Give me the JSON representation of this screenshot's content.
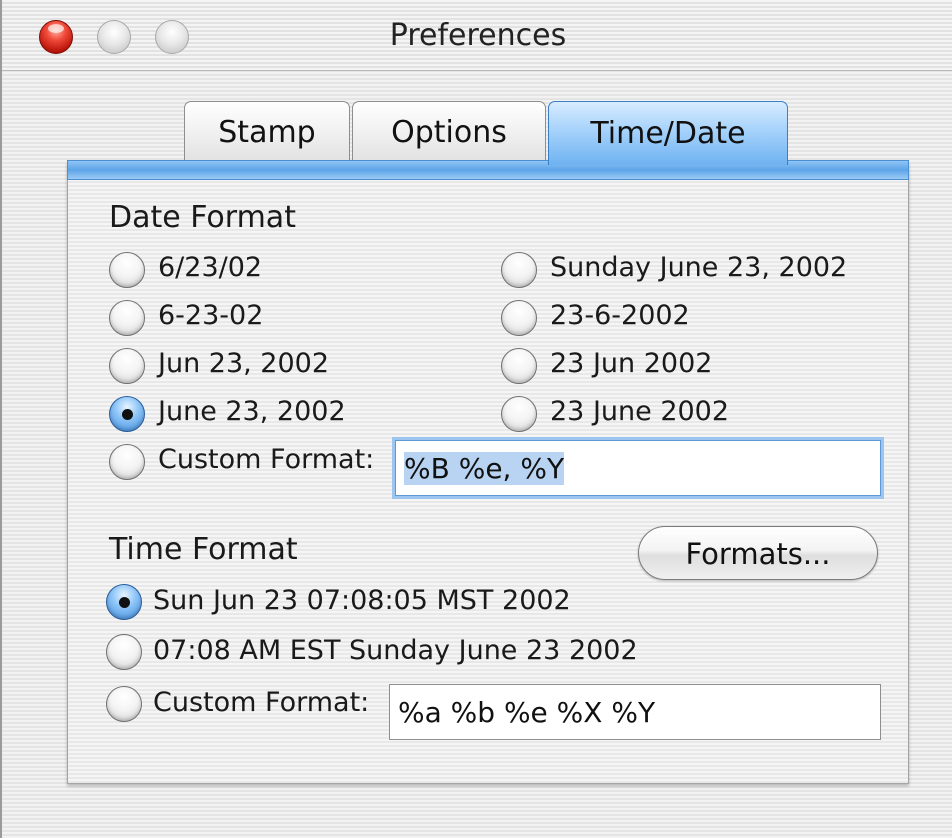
{
  "window": {
    "title": "Preferences"
  },
  "tabs": [
    {
      "label": "Stamp",
      "selected": false
    },
    {
      "label": "Options",
      "selected": false
    },
    {
      "label": "Time/Date",
      "selected": true
    }
  ],
  "date_format": {
    "heading": "Date Format",
    "options": [
      {
        "label": "6/23/02",
        "selected": false
      },
      {
        "label": "6-23-02",
        "selected": false
      },
      {
        "label": "Jun 23, 2002",
        "selected": false
      },
      {
        "label": "June 23, 2002",
        "selected": true
      },
      {
        "label": "Sunday June 23, 2002",
        "selected": false
      },
      {
        "label": "23-6-2002",
        "selected": false
      },
      {
        "label": "23 Jun 2002",
        "selected": false
      },
      {
        "label": "23 June 2002",
        "selected": false
      }
    ],
    "custom_label": "Custom Format:",
    "custom_selected": false,
    "custom_value": "%B %e, %Y"
  },
  "time_format": {
    "heading": "Time Format",
    "formats_button": "Formats...",
    "options": [
      {
        "label": "Sun Jun 23 07:08:05 MST 2002",
        "selected": true
      },
      {
        "label": "07:08 AM EST Sunday June 23 2002",
        "selected": false
      }
    ],
    "custom_label": "Custom Format:",
    "custom_selected": false,
    "custom_value": "%a %b %e %X %Y"
  },
  "colors": {
    "accent": "#6eb2f1",
    "selection": "#b8d4f2",
    "close_button": "#e0291b"
  }
}
